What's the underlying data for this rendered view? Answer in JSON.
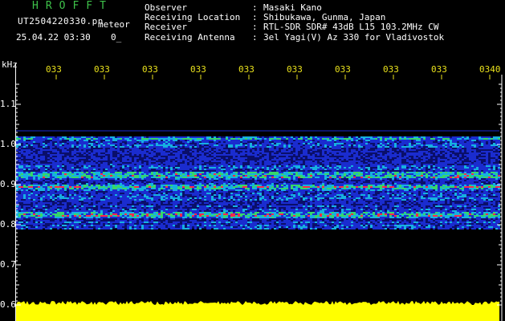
{
  "header": {
    "brand": "HROFFT",
    "filename": "UT2504220330.pn",
    "filename_suffix": "meteor",
    "timestamp": "25.04.22 03:30",
    "count": "0_"
  },
  "info": [
    {
      "key": "Observer",
      "sep": ":",
      "value": "Masaki Kano"
    },
    {
      "key": "Receiving Location",
      "sep": ":",
      "value": "Shibukawa, Gunma, Japan"
    },
    {
      "key": "Receiver",
      "sep": ":",
      "value": "RTL-SDR SDR# 43dB L15 103.2MHz CW"
    },
    {
      "key": "Receiving Antenna",
      "sep": ":",
      "value": "3el Yagi(V) Az 330 for Vladivostok"
    }
  ],
  "chart_data": {
    "type": "heatmap",
    "ylabel": "kHz",
    "y_ticks": [
      "1.1",
      "1.0",
      "0.9",
      "0.8",
      "0.7",
      "0.6"
    ],
    "y_tick_values": [
      1.1,
      1.0,
      0.9,
      0.8,
      0.7,
      0.6
    ],
    "ylim": [
      0.6,
      1.1
    ],
    "x_ticks": [
      "033",
      "033",
      "033",
      "033",
      "033",
      "033",
      "033",
      "033",
      "033",
      "0340"
    ],
    "noise_band_khz": [
      0.79,
      1.02
    ],
    "strong_lines_khz": [
      0.925,
      0.895,
      0.825
    ],
    "colors": {
      "background": "#000000",
      "noise_low": "#1a2ccf",
      "noise_mid": "#16b0e0",
      "noise_high": "#36d66a",
      "peak": "#ff2a4a",
      "amplitude": "#ffff00",
      "axis": "#ffffff",
      "time_labels": "#e8e01c",
      "brand": "#3ec24a"
    }
  }
}
